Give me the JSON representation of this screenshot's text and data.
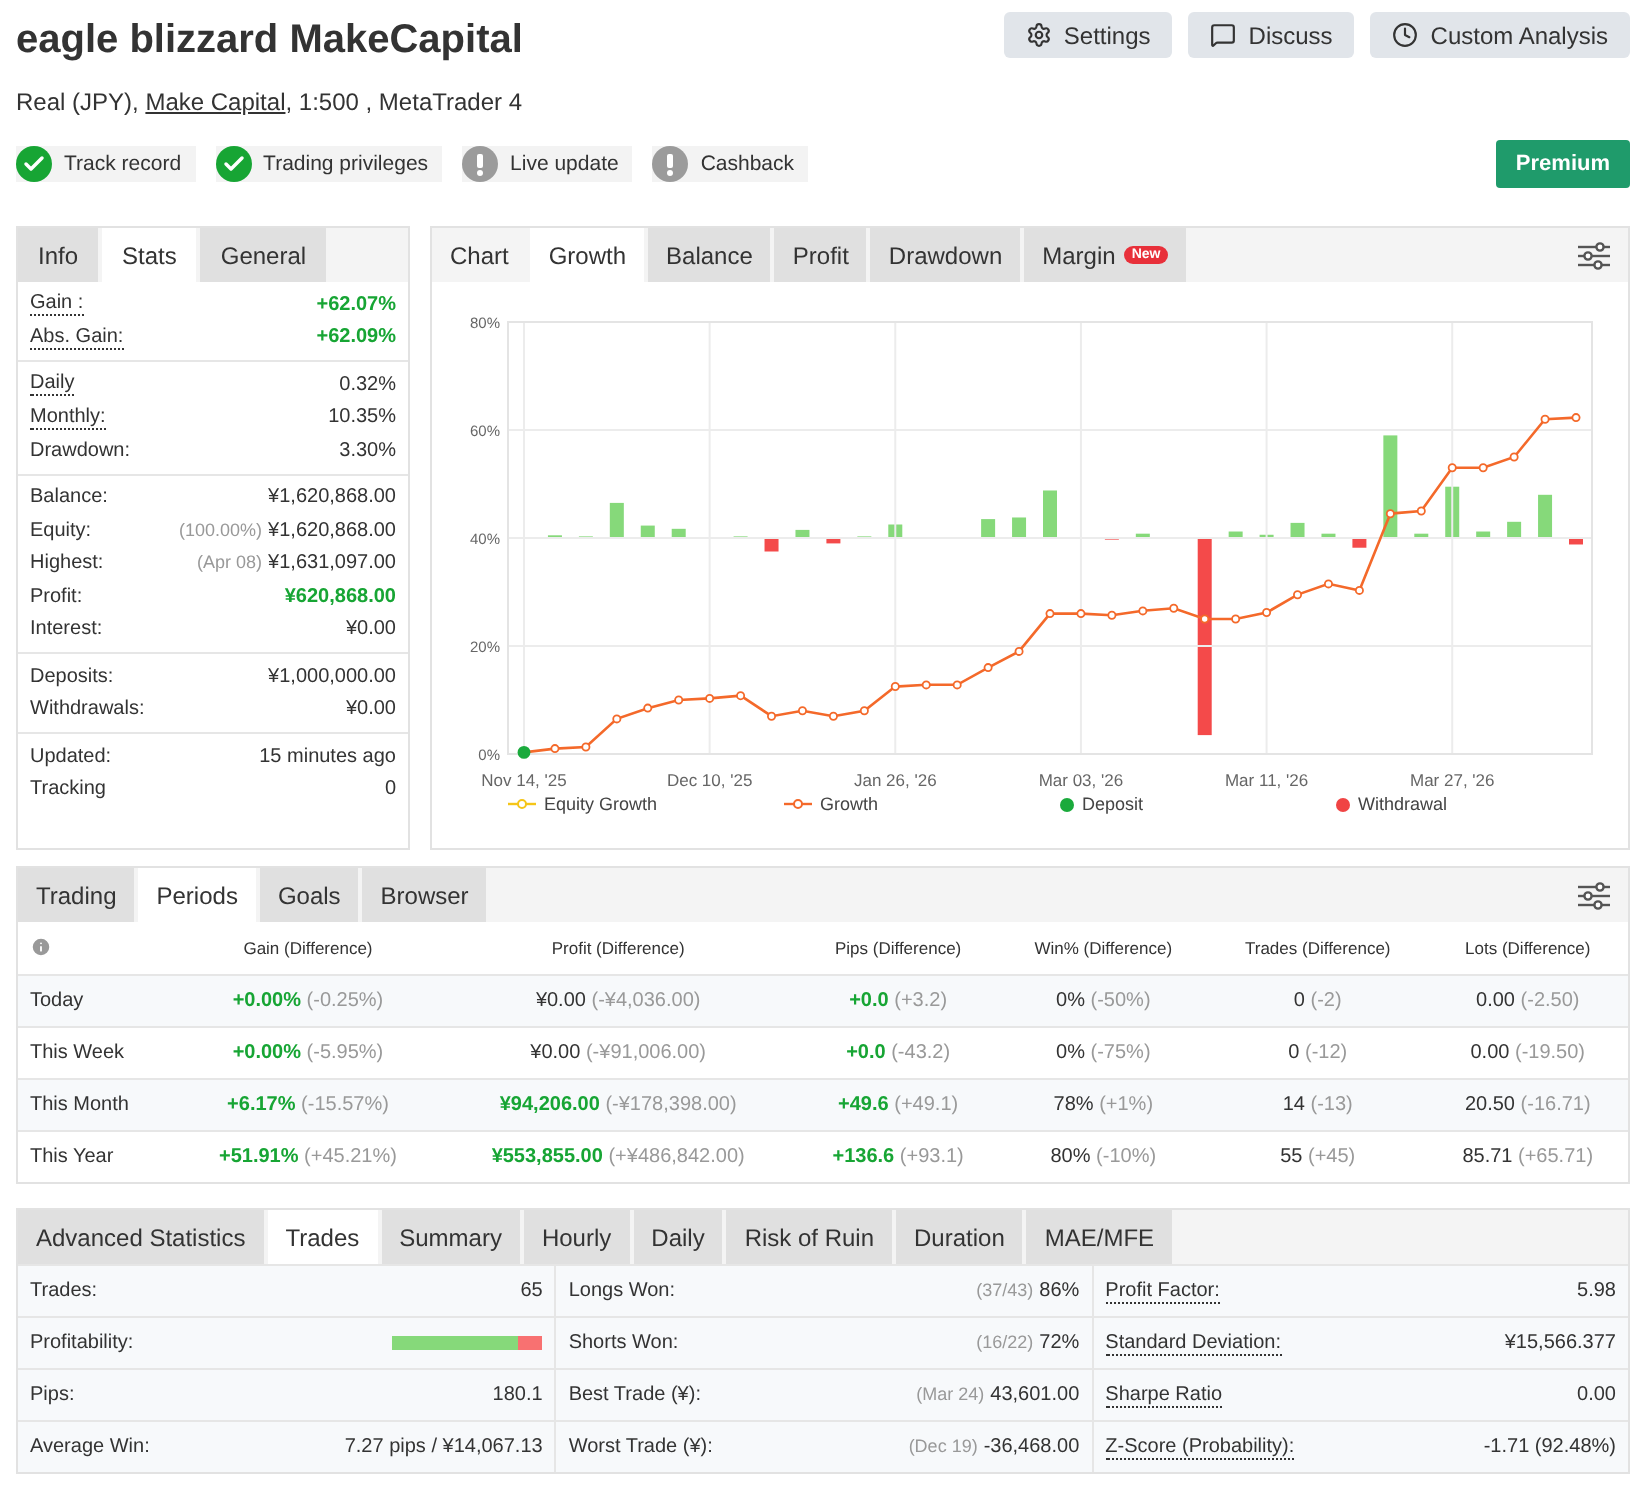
{
  "header": {
    "title": "eagle blizzard MakeCapital",
    "subtitle_prefix": "Real (JPY),",
    "broker_link": "Make Capital",
    "subtitle_suffix": ", 1:500 , MetaTrader 4",
    "actions": [
      {
        "kind": "gear",
        "label": "Settings"
      },
      {
        "kind": "chat",
        "label": "Discuss"
      },
      {
        "kind": "clock",
        "label": "Custom Analysis"
      }
    ],
    "badges": [
      {
        "label": "Track record",
        "verified": true
      },
      {
        "label": "Trading privileges",
        "verified": true
      },
      {
        "label": "Live update",
        "verified": false
      },
      {
        "label": "Cashback",
        "verified": false
      }
    ],
    "premium": "Premium"
  },
  "stats_panel": {
    "tabs": [
      {
        "label": "Info",
        "selected": false
      },
      {
        "label": "Stats",
        "selected": true
      },
      {
        "label": "General",
        "selected": false
      }
    ],
    "groups": [
      [
        {
          "label": "Gain :",
          "value": "+62.07%",
          "dotted": true,
          "green": true
        },
        {
          "label": "Abs. Gain:",
          "value": "+62.09%",
          "dotted": true,
          "green": true
        }
      ],
      [
        {
          "label": "Daily",
          "value": "0.32%",
          "dotted": true,
          "green": false
        },
        {
          "label": "Monthly:",
          "value": "10.35%",
          "dotted": true,
          "green": false
        },
        {
          "label": "Drawdown:",
          "value": "3.30%",
          "dotted": false,
          "green": false
        }
      ],
      [
        {
          "label": "Balance:",
          "value": "¥1,620,868.00",
          "dotted": false,
          "green": false
        },
        {
          "label": "Equity:",
          "note": "(100.00%)",
          "value": "¥1,620,868.00",
          "dotted": false,
          "green": false
        },
        {
          "label": "Highest:",
          "note": "(Apr 08)",
          "value": "¥1,631,097.00",
          "dotted": false,
          "green": false
        },
        {
          "label": "Profit:",
          "value": "¥620,868.00",
          "dotted": false,
          "green": true
        },
        {
          "label": "Interest:",
          "value": "¥0.00",
          "dotted": false,
          "green": false
        }
      ],
      [
        {
          "label": "Deposits:",
          "value": "¥1,000,000.00",
          "dotted": false,
          "green": false
        },
        {
          "label": "Withdrawals:",
          "value": "¥0.00",
          "dotted": false,
          "green": false
        }
      ],
      [
        {
          "label": "Updated:",
          "value": "15 minutes ago",
          "dotted": false,
          "green": false
        },
        {
          "label": "Tracking",
          "value": "0",
          "dotted": false,
          "green": false
        }
      ]
    ]
  },
  "chart_panel": {
    "heading": "Chart",
    "tabs": [
      {
        "label": "Growth",
        "selected": true
      },
      {
        "label": "Balance",
        "selected": false
      },
      {
        "label": "Profit",
        "selected": false
      },
      {
        "label": "Drawdown",
        "selected": false
      },
      {
        "label": "Margin",
        "selected": false,
        "badge": "New"
      }
    ],
    "chart_data": {
      "type": "line",
      "categories": [
        "Nov 14, '25",
        null,
        null,
        null,
        null,
        null,
        "Dec 10, '25",
        null,
        null,
        null,
        null,
        null,
        "Jan 26, '26",
        null,
        null,
        null,
        null,
        null,
        "Mar 03, '26",
        null,
        null,
        null,
        null,
        null,
        "Mar 11, '26",
        null,
        null,
        null,
        null,
        null,
        "Mar 27, '26",
        null,
        null,
        null,
        null
      ],
      "yticks": [
        {
          "value": 0,
          "label": "0%"
        },
        {
          "value": 20,
          "label": "20%"
        },
        {
          "value": 40,
          "label": "40%"
        },
        {
          "value": 60,
          "label": "60%"
        },
        {
          "value": 80,
          "label": "80%"
        }
      ],
      "ylim": [
        0,
        80
      ],
      "grid": true,
      "series": [
        {
          "name": "Growth",
          "color": "#f4692a",
          "marker": true,
          "values": [
            0.3,
            1,
            1.3,
            6.5,
            8.5,
            10,
            10.3,
            10.8,
            7,
            8,
            7,
            8,
            12.5,
            12.8,
            12.8,
            16,
            19,
            26,
            26,
            25.7,
            26.5,
            27,
            25,
            25,
            26.2,
            29.5,
            31.5,
            30.3,
            44.5,
            45,
            53,
            53,
            55,
            62,
            62.3
          ]
        }
      ]
    },
    "legend": [
      {
        "kind": "line",
        "label": "Equity Growth",
        "color": "#f5c518"
      },
      {
        "kind": "dot",
        "label": "Deposit",
        "color": "#1aaa3c"
      },
      {
        "kind": "dot",
        "label": "Withdrawal",
        "color": "#f04444"
      }
    ]
  },
  "periods_panel": {
    "tabs": [
      {
        "label": "Trading",
        "selected": false
      },
      {
        "label": "Periods",
        "selected": true
      },
      {
        "label": "Goals",
        "selected": false
      },
      {
        "label": "Browser",
        "selected": false
      }
    ],
    "columns": [
      "Gain (Difference)",
      "Profit (Difference)",
      "Pips (Difference)",
      "Win% (Difference)",
      "Trades (Difference)",
      "Lots (Difference)"
    ],
    "rows": [
      {
        "period": "Today",
        "cells": [
          {
            "value": "+0.00%",
            "diff": "(-0.25%)",
            "green": true
          },
          {
            "value": "¥0.00",
            "diff": "(-¥4,036.00)",
            "green": false
          },
          {
            "value": "+0.0",
            "diff": "(+3.2)",
            "green": true
          },
          {
            "value": "0%",
            "diff": "(-50%)",
            "green": false
          },
          {
            "value": "0",
            "diff": "(-2)",
            "green": false
          },
          {
            "value": "0.00",
            "diff": "(-2.50)",
            "green": false
          }
        ]
      },
      {
        "period": "This Week",
        "cells": [
          {
            "value": "+0.00%",
            "diff": "(-5.95%)",
            "green": true
          },
          {
            "value": "¥0.00",
            "diff": "(-¥91,006.00)",
            "green": false
          },
          {
            "value": "+0.0",
            "diff": "(-43.2)",
            "green": true
          },
          {
            "value": "0%",
            "diff": "(-75%)",
            "green": false
          },
          {
            "value": "0",
            "diff": "(-12)",
            "green": false
          },
          {
            "value": "0.00",
            "diff": "(-19.50)",
            "green": false
          }
        ]
      },
      {
        "period": "This Month",
        "cells": [
          {
            "value": "+6.17%",
            "diff": "(-15.57%)",
            "green": true
          },
          {
            "value": "¥94,206.00",
            "diff": "(-¥178,398.00)",
            "green": true
          },
          {
            "value": "+49.6",
            "diff": "(+49.1)",
            "green": true
          },
          {
            "value": "78%",
            "diff": "(+1%)",
            "green": false
          },
          {
            "value": "14",
            "diff": "(-13)",
            "green": false
          },
          {
            "value": "20.50",
            "diff": "(-16.71)",
            "green": false
          }
        ]
      },
      {
        "period": "This Year",
        "cells": [
          {
            "value": "+51.91%",
            "diff": "(+45.21%)",
            "green": true
          },
          {
            "value": "¥553,855.00",
            "diff": "(+¥486,842.00)",
            "green": true
          },
          {
            "value": "+136.6",
            "diff": "(+93.1)",
            "green": true
          },
          {
            "value": "80%",
            "diff": "(-10%)",
            "green": false
          },
          {
            "value": "55",
            "diff": "(+45)",
            "green": false
          },
          {
            "value": "85.71",
            "diff": "(+65.71)",
            "green": false
          }
        ]
      }
    ]
  },
  "advanced_panel": {
    "tabs": [
      {
        "label": "Advanced Statistics",
        "selected": false
      },
      {
        "label": "Trades",
        "selected": true
      },
      {
        "label": "Summary",
        "selected": false
      },
      {
        "label": "Hourly",
        "selected": false
      },
      {
        "label": "Daily",
        "selected": false
      },
      {
        "label": "Risk of Ruin",
        "selected": false
      },
      {
        "label": "Duration",
        "selected": false
      },
      {
        "label": "MAE/MFE",
        "selected": false
      }
    ],
    "rows": [
      [
        {
          "kind": "text",
          "label": "Trades:",
          "value": "65",
          "dotted": false
        },
        {
          "kind": "text",
          "label": "Longs Won:",
          "note": "(37/43)",
          "value": "86%",
          "dotted": false
        },
        {
          "kind": "text",
          "label": "Profit Factor:",
          "value": "5.98",
          "dotted": true
        }
      ],
      [
        {
          "kind": "bar",
          "label": "Profitability:",
          "level": 0.84,
          "dotted": false
        },
        {
          "kind": "text",
          "label": "Shorts Won:",
          "note": "(16/22)",
          "value": "72%",
          "dotted": false
        },
        {
          "kind": "text",
          "label": "Standard Deviation:",
          "value": "¥15,566.377",
          "dotted": true
        }
      ],
      [
        {
          "kind": "text",
          "label": "Pips:",
          "value": "180.1",
          "dotted": false
        },
        {
          "kind": "text",
          "label": "Best Trade (¥):",
          "note": "(Mar 24)",
          "value": "43,601.00",
          "dotted": false
        },
        {
          "kind": "text",
          "label": "Sharpe Ratio",
          "value": "0.00",
          "dotted": true
        }
      ],
      [
        {
          "kind": "text",
          "label": "Average Win:",
          "value": "7.27 pips / ¥14,067.13",
          "dotted": false
        },
        {
          "kind": "text",
          "label": "Worst Trade (¥):",
          "note": "(Dec 19)",
          "value": "-36,468.00",
          "dotted": false
        },
        {
          "kind": "text",
          "label": "Z-Score (Probability):",
          "value": "-1.71 (92.48%)",
          "dotted": true
        }
      ]
    ]
  }
}
